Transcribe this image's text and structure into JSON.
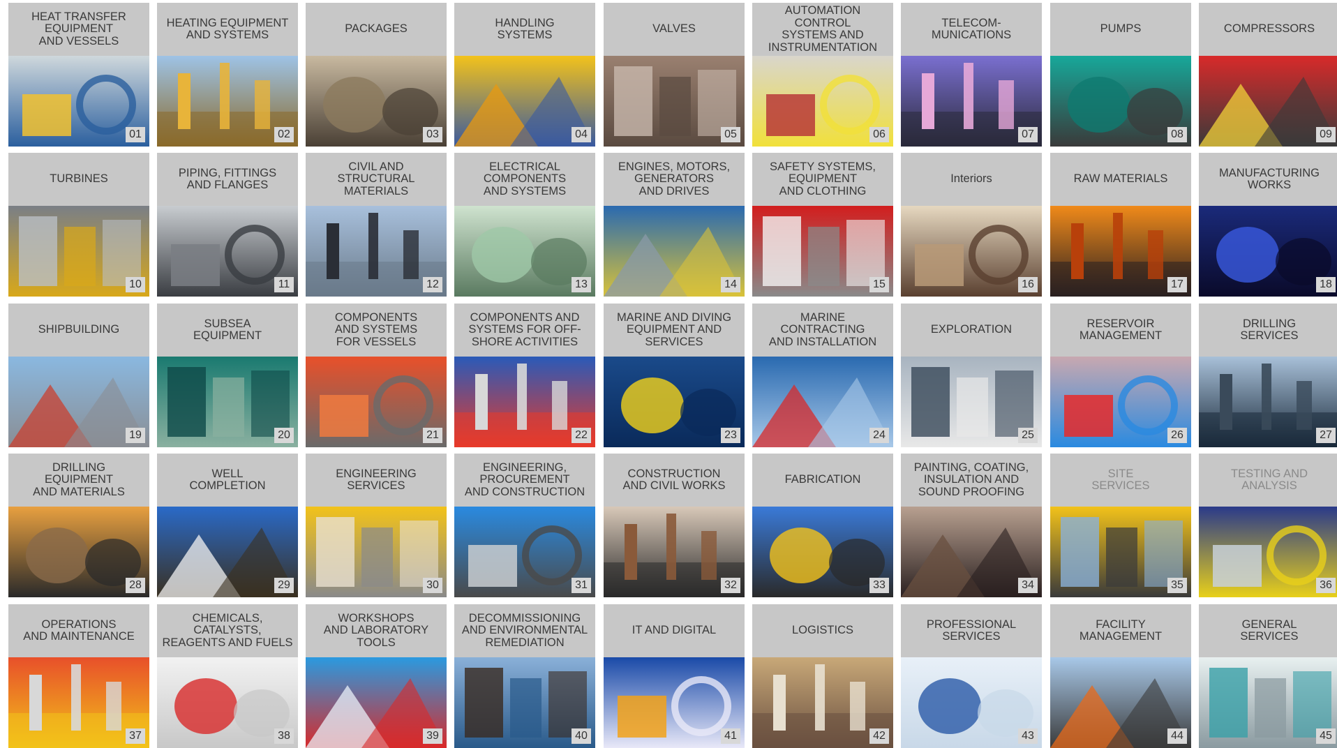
{
  "tiles": [
    {
      "label": "HEAT TRANSFER\nEQUIPMENT\nAND VESSELS",
      "number": "01",
      "icon": "heat-exchanger-photo",
      "colors": [
        "#cfd8dc",
        "#f2c230",
        "#2b5f9e"
      ]
    },
    {
      "label": "HEATING EQUIPMENT\nAND SYSTEMS",
      "number": "02",
      "icon": "heating-plant-photo",
      "colors": [
        "#9ec3e6",
        "#e8b43a",
        "#8a6a2a"
      ]
    },
    {
      "label": "PACKAGES",
      "number": "03",
      "icon": "compressor-package-photo",
      "colors": [
        "#c8b9a0",
        "#8c7a5e",
        "#4a4035"
      ]
    },
    {
      "label": "HANDLING\nSYSTEMS",
      "number": "04",
      "icon": "crane-photo",
      "colors": [
        "#f3c21b",
        "#e89a10",
        "#3a5aa0"
      ]
    },
    {
      "label": "VALVES",
      "number": "05",
      "icon": "flanges-photo",
      "colors": [
        "#9a8070",
        "#c8b8ac",
        "#5a4a40"
      ]
    },
    {
      "label": "AUTOMATION\nCONTROL\nSYSTEMS AND\nINSTRUMENTATION",
      "number": "06",
      "icon": "control-room-photo",
      "colors": [
        "#d9d6cc",
        "#b83a3a",
        "#f1e03a"
      ]
    },
    {
      "label": "TELECOM-\nMUNICATIONS",
      "number": "07",
      "icon": "satellite-dish-photo",
      "colors": [
        "#7a6fd0",
        "#e6a8d8",
        "#2a2a3a"
      ]
    },
    {
      "label": "PUMPS",
      "number": "08",
      "icon": "pump-photo",
      "colors": [
        "#17a89a",
        "#0f7a70",
        "#3a3a3a"
      ]
    },
    {
      "label": "COMPRESSORS",
      "number": "09",
      "icon": "compressor-photo",
      "colors": [
        "#d82a2a",
        "#f2d23a",
        "#3a3a3a"
      ]
    },
    {
      "label": "TURBINES",
      "number": "10",
      "icon": "turbine-photo",
      "colors": [
        "#7a7f86",
        "#b9bec4",
        "#d8a81a"
      ]
    },
    {
      "label": "PIPING, FITTINGS\nAND FLANGES",
      "number": "11",
      "icon": "pipes-photo",
      "colors": [
        "#c8ccd0",
        "#7a7e84",
        "#3a3d42"
      ]
    },
    {
      "label": "CIVIL AND\nSTRUCTURAL\nMATERIALS",
      "number": "12",
      "icon": "steel-structure-photo",
      "colors": [
        "#a8c0dc",
        "#2a2e36",
        "#6a7a8a"
      ]
    },
    {
      "label": "ELECTRICAL\nCOMPONENTS\nAND SYSTEMS",
      "number": "13",
      "icon": "switchgear-photo",
      "colors": [
        "#cfe3cf",
        "#9fc8a8",
        "#5a7a60"
      ]
    },
    {
      "label": "ENGINES, MOTORS,\nGENERATORS\nAND DRIVES",
      "number": "14",
      "icon": "motors-photo",
      "colors": [
        "#2a6ab0",
        "#8a9aa8",
        "#d8c23a"
      ]
    },
    {
      "label": "SAFETY SYSTEMS,\nEQUIPMENT\nAND CLOTHING",
      "number": "15",
      "icon": "fire-system-photo",
      "colors": [
        "#d21e1e",
        "#f2f2f2",
        "#8a8a8a"
      ]
    },
    {
      "label": "Interiors",
      "number": "16",
      "icon": "bedroom-photo",
      "colors": [
        "#e6d8c0",
        "#b89a78",
        "#5a4030"
      ]
    },
    {
      "label": "RAW MATERIALS",
      "number": "17",
      "icon": "molten-metal-photo",
      "colors": [
        "#f08a1a",
        "#b8400a",
        "#2a2020"
      ]
    },
    {
      "label": "MANUFACTURING\nWORKS",
      "number": "18",
      "icon": "welding-photo",
      "colors": [
        "#1a2a7a",
        "#3a5ae0",
        "#0a0a2a"
      ]
    },
    {
      "label": "SHIPBUILDING",
      "number": "19",
      "icon": "ship-dock-photo",
      "colors": [
        "#8ab8e0",
        "#c84030",
        "#8a8e94"
      ]
    },
    {
      "label": "SUBSEA\nEQUIPMENT",
      "number": "20",
      "icon": "subsea-photo",
      "colors": [
        "#1a7a70",
        "#0e4a48",
        "#8ab0a0"
      ]
    },
    {
      "label": "COMPONENTS\nAND SYSTEMS\nFOR VESSELS",
      "number": "21",
      "icon": "propeller-photo",
      "colors": [
        "#e8502a",
        "#f07a40",
        "#6a6a6a"
      ]
    },
    {
      "label": "COMPONENTS AND\nSYSTEMS FOR OFF-\nSHORE ACTIVITIES",
      "number": "22",
      "icon": "offshore-equipment-photo",
      "colors": [
        "#2a5ab8",
        "#d8d8d8",
        "#e83a2a"
      ]
    },
    {
      "label": "MARINE AND DIVING\nEQUIPMENT AND\nSERVICES",
      "number": "23",
      "icon": "rov-photo",
      "colors": [
        "#1a4a8a",
        "#f2d21a",
        "#0a2a5a"
      ]
    },
    {
      "label": "MARINE\nCONTRACTING\nAND INSTALLATION",
      "number": "24",
      "icon": "supply-vessel-photo",
      "colors": [
        "#2a6ab0",
        "#d82a2a",
        "#a8c8e8"
      ]
    },
    {
      "label": "EXPLORATION",
      "number": "25",
      "icon": "control-desk-photo",
      "colors": [
        "#a8b4c0",
        "#3a4a5a",
        "#e8e8e8"
      ]
    },
    {
      "label": "RESERVOIR\nMANAGEMENT",
      "number": "26",
      "icon": "reservoir-model-photo",
      "colors": [
        "#c8a8b0",
        "#e82a2a",
        "#2a8ae0"
      ]
    },
    {
      "label": "DRILLING\nSERVICES",
      "number": "27",
      "icon": "drilling-rig-photo",
      "colors": [
        "#a8c0d8",
        "#3a4a5a",
        "#1a2a3a"
      ]
    },
    {
      "label": "DRILLING\nEQUIPMENT\nAND MATERIALS",
      "number": "28",
      "icon": "rig-sunset-photo",
      "colors": [
        "#e8a040",
        "#8a6a4a",
        "#2a2a2a"
      ]
    },
    {
      "label": "WELL\nCOMPLETION",
      "number": "29",
      "icon": "worker-pipe-photo",
      "colors": [
        "#2a6ac8",
        "#f2f2f2",
        "#3a3020"
      ]
    },
    {
      "label": "ENGINEERING\nSERVICES",
      "number": "30",
      "icon": "hardhat-blueprint-photo",
      "colors": [
        "#f2c21a",
        "#e8e0d0",
        "#8a8a8a"
      ]
    },
    {
      "label": "ENGINEERING,\nPROCUREMENT\nAND CONSTRUCTION",
      "number": "31",
      "icon": "refinery-photo",
      "colors": [
        "#2a8ae0",
        "#c8ccd0",
        "#4a4a4a"
      ]
    },
    {
      "label": "CONSTRUCTION\nAND CIVIL WORKS",
      "number": "32",
      "icon": "pipe-welder-photo",
      "colors": [
        "#d8c8b8",
        "#8a5a3a",
        "#2a2a2a"
      ]
    },
    {
      "label": "FABRICATION",
      "number": "33",
      "icon": "process-plant-photo",
      "colors": [
        "#3a7ad8",
        "#f2c21a",
        "#2a2a2a"
      ]
    },
    {
      "label": "PAINTING, COATING,\nINSULATION AND\nSOUND PROOFING",
      "number": "34",
      "icon": "sandblasting-photo",
      "colors": [
        "#b8a090",
        "#6a5040",
        "#2a2020"
      ]
    },
    {
      "label": "SITE\nSERVICES",
      "number": "35",
      "icon": "mining-truck-photo",
      "colors": [
        "#f2c21a",
        "#8ab0d8",
        "#3a3a3a"
      ]
    },
    {
      "label": "TESTING AND\nANALYSIS",
      "number": "36",
      "icon": "pipe-inspection-photo",
      "colors": [
        "#2a3a8a",
        "#c8d0d8",
        "#e8d01a"
      ]
    },
    {
      "label": "OPERATIONS\nAND MAINTENANCE",
      "number": "37",
      "icon": "technician-photo",
      "colors": [
        "#e8502a",
        "#d8d8d8",
        "#f2c21a"
      ]
    },
    {
      "label": "CHEMICALS,\nCATALYSTS,\nREAGENTS AND FUELS",
      "number": "38",
      "icon": "canisters-photo",
      "colors": [
        "#f2f2f2",
        "#d82a2a",
        "#c8c8c8"
      ]
    },
    {
      "label": "WORKSHOPS\nAND LABORATORY\nTOOLS",
      "number": "39",
      "icon": "lab-tools-photo",
      "colors": [
        "#2a9ae0",
        "#e8f0f8",
        "#d82a2a"
      ]
    },
    {
      "label": "DECOMMISSIONING\nAND ENVIRONMENTAL\nREMEDIATION",
      "number": "40",
      "icon": "platform-removal-photo",
      "colors": [
        "#8ab0d8",
        "#3a2a20",
        "#2a5a8a"
      ]
    },
    {
      "label": "IT AND DIGITAL",
      "number": "41",
      "icon": "digital-plant-photo",
      "colors": [
        "#1a4aa8",
        "#f2a21a",
        "#e8e8f8"
      ]
    },
    {
      "label": "LOGISTICS",
      "number": "42",
      "icon": "warehouse-photo",
      "colors": [
        "#c8a878",
        "#e8e0d0",
        "#6a5040"
      ]
    },
    {
      "label": "PROFESSIONAL\nSERVICES",
      "number": "43",
      "icon": "business-people-photo",
      "colors": [
        "#e8f0f8",
        "#2a5aa8",
        "#c8d8e8"
      ]
    },
    {
      "label": "FACILITY\nMANAGEMENT",
      "number": "44",
      "icon": "rope-access-photo",
      "colors": [
        "#a8c8e8",
        "#e86a1a",
        "#3a3a3a"
      ]
    },
    {
      "label": "GENERAL\nSERVICES",
      "number": "45",
      "icon": "office-photo",
      "colors": [
        "#e8f0f0",
        "#3aa0a8",
        "#8a9aa0"
      ]
    }
  ],
  "dimmed_numbers": [
    "35",
    "36"
  ]
}
